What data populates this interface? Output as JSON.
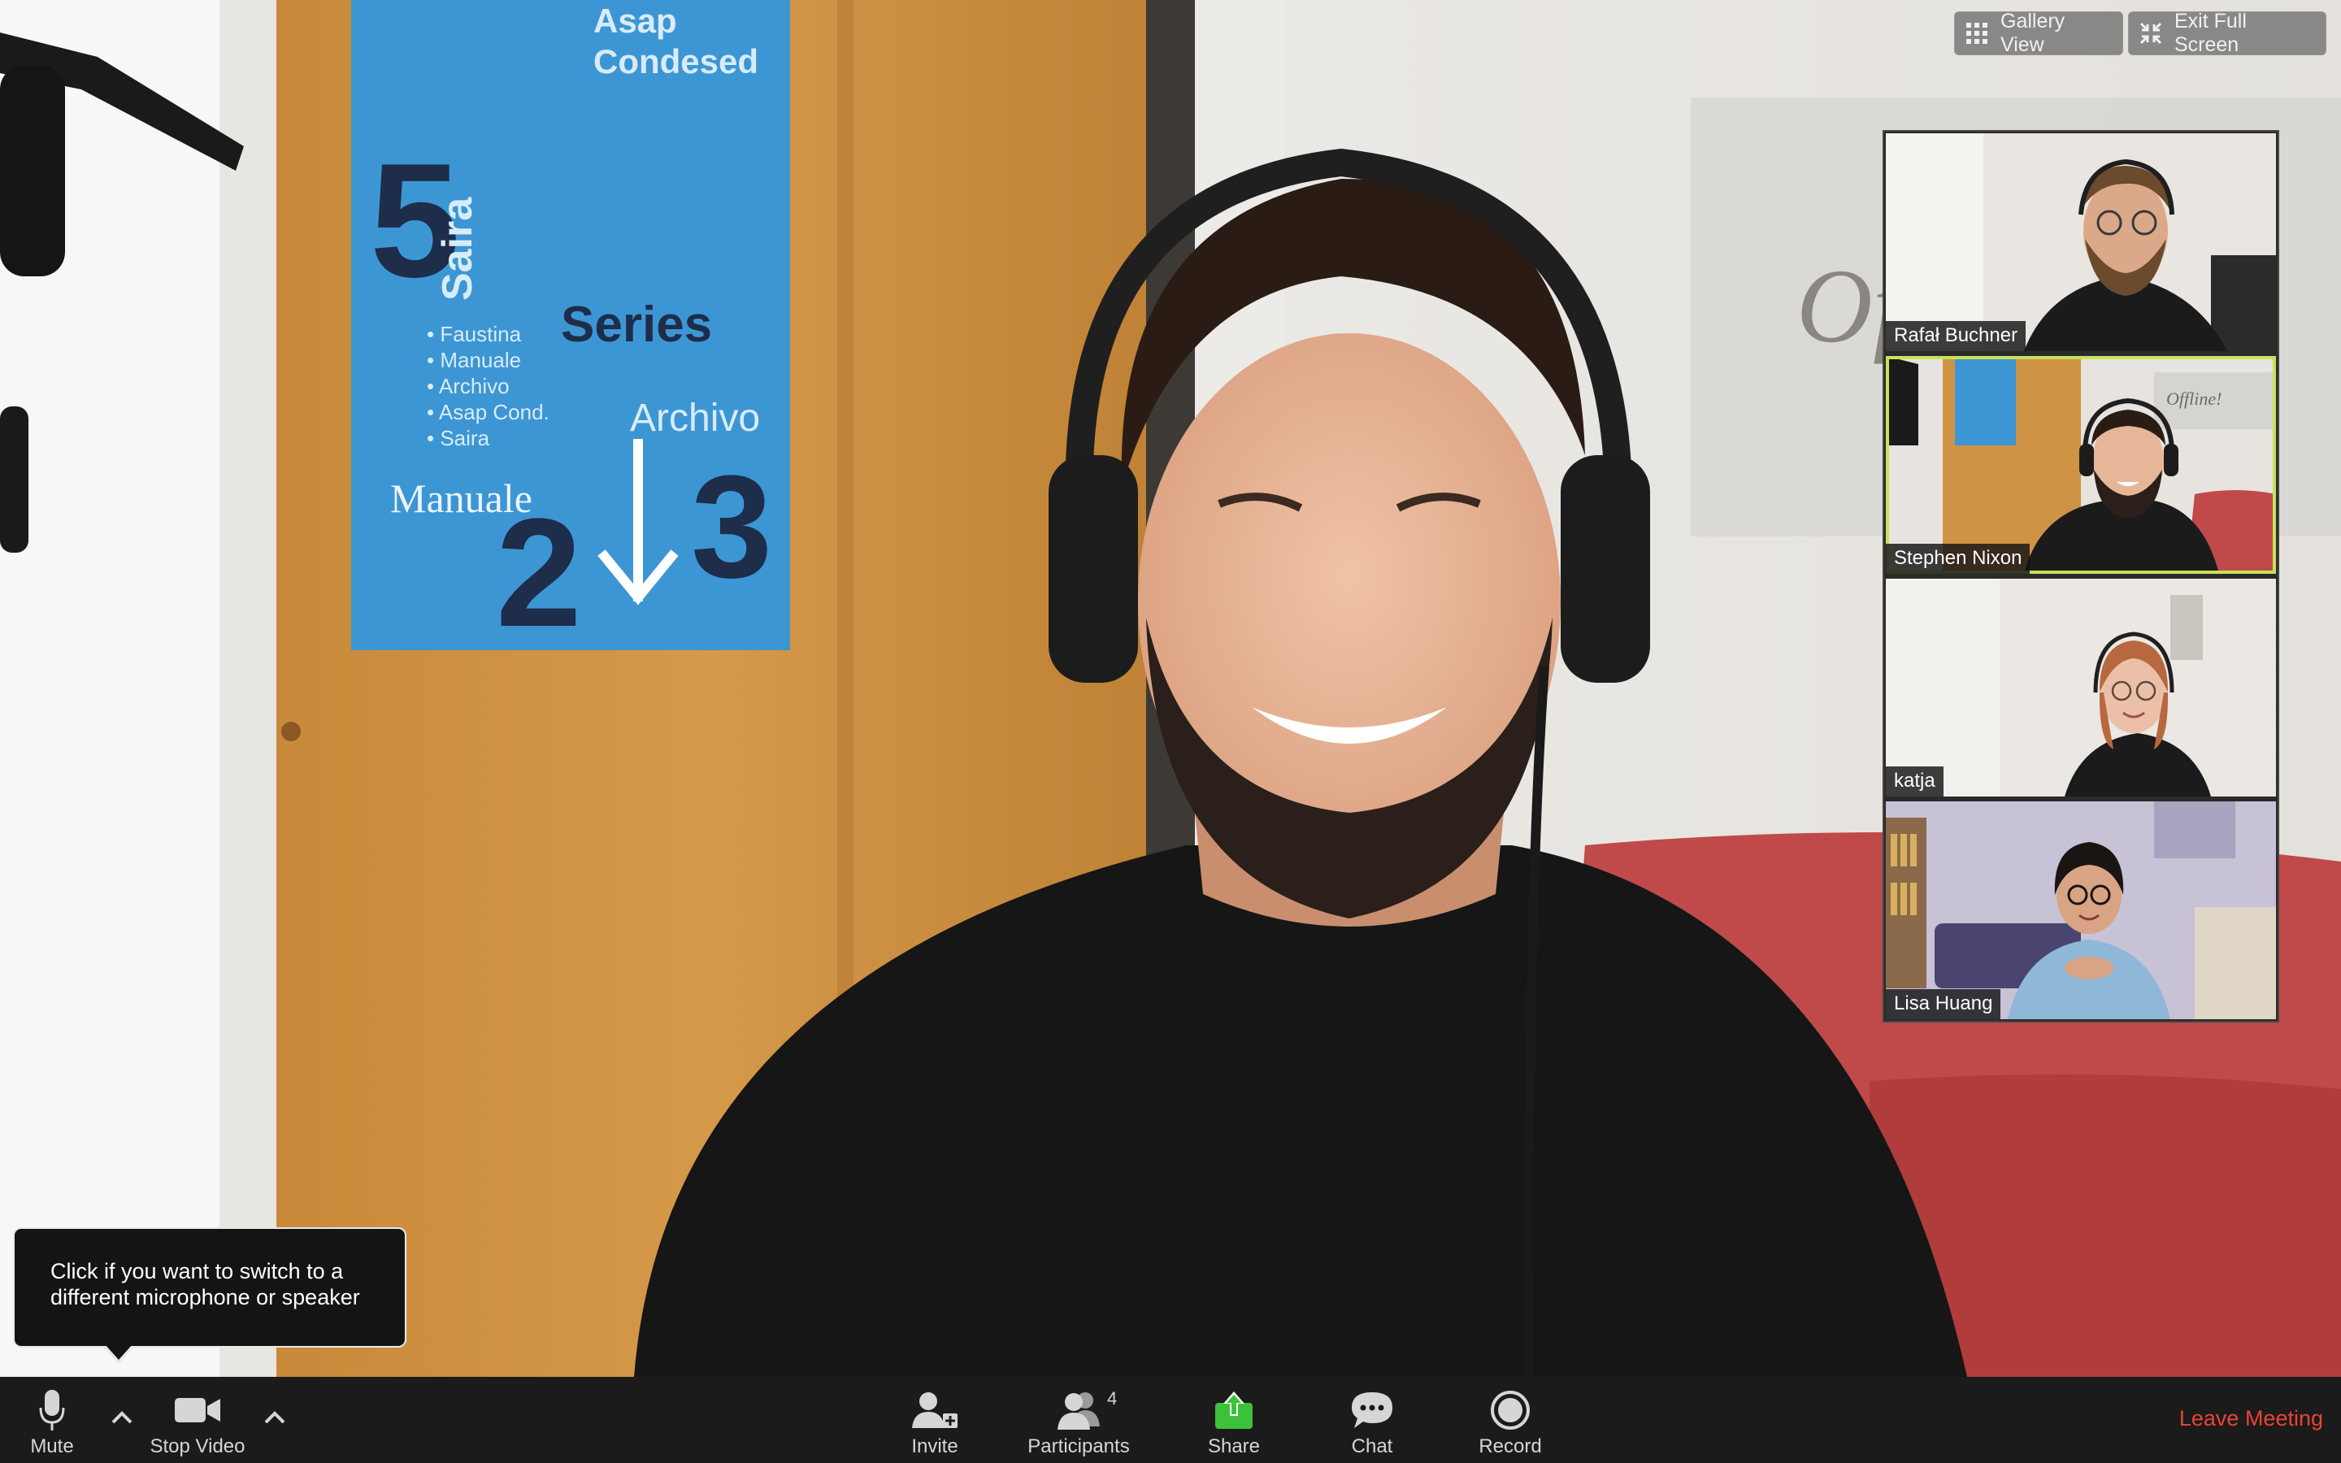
{
  "top_controls": {
    "gallery_view_label": "Gallery View",
    "gallery_view_icon": "grid-icon",
    "exit_fullscreen_label": "Exit Full Screen",
    "exit_fullscreen_icon": "collapse-arrows-icon"
  },
  "active_speaker": {
    "name": "Stephen Nixon"
  },
  "participants": [
    {
      "name": "Rafał Buchner",
      "active": false
    },
    {
      "name": "Stephen Nixon",
      "active": true
    },
    {
      "name": "katja",
      "active": false
    },
    {
      "name": "Lisa Huang",
      "active": false
    }
  ],
  "background_text": {
    "poster_lines": [
      "Asap Condesed",
      "Saira",
      "Archivo",
      "Manuale",
      "Series"
    ],
    "poster_numbers": [
      "5",
      "2",
      "3"
    ],
    "poster_list": [
      "Faustina",
      "Manuale",
      "Archivo",
      "Asap Cond.",
      "Saira"
    ],
    "wall_sign": "Offline!"
  },
  "tooltip": {
    "text_line1": "Click if you want to switch to a",
    "text_line2": "different microphone or speaker"
  },
  "toolbar": {
    "mute_label": "Mute",
    "mute_icon": "microphone-icon",
    "stop_video_label": "Stop Video",
    "stop_video_icon": "video-camera-icon",
    "invite_label": "Invite",
    "invite_icon": "add-person-icon",
    "participants_label": "Participants",
    "participants_icon": "people-icon",
    "participants_count": "4",
    "share_label": "Share",
    "share_icon": "share-screen-icon",
    "chat_label": "Chat",
    "chat_icon": "chat-bubble-icon",
    "record_label": "Record",
    "record_icon": "record-icon",
    "leave_label": "Leave Meeting"
  },
  "colors": {
    "toolbar_bg": "#1b1b1b",
    "share_green": "#3cc13b",
    "leave_red": "#ea4335",
    "active_outline": "#c8e25a"
  }
}
